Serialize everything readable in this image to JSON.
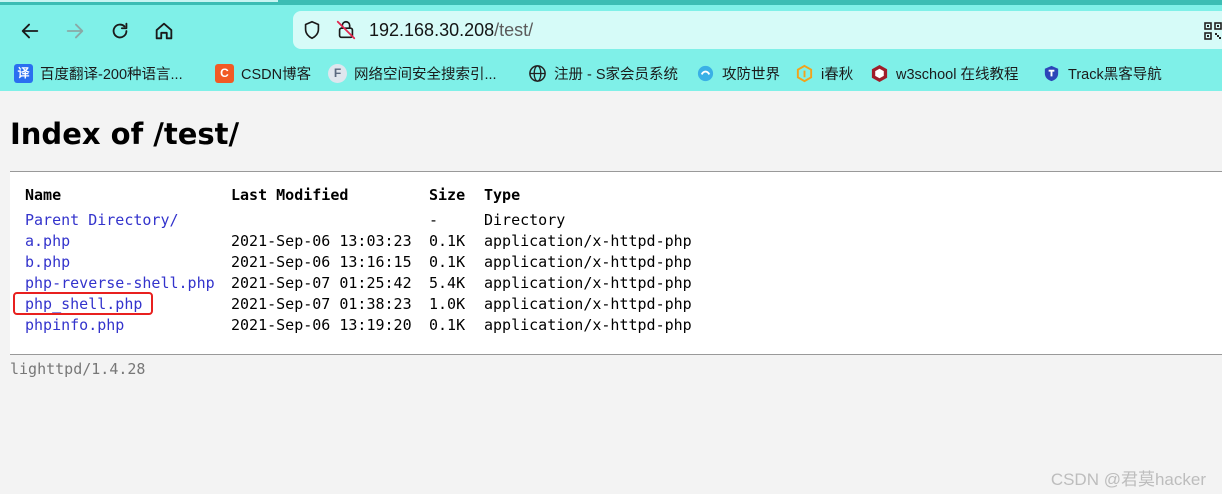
{
  "browser": {
    "url_host": "192.168.30.208",
    "url_path": "/test/",
    "bookmarks": [
      {
        "label": "百度翻译-200种语言...",
        "icon": "baidu-translate-icon",
        "icon_glyph": "译",
        "color": "#2a6ff0"
      },
      {
        "label": "CSDN博客",
        "icon": "csdn-icon",
        "icon_glyph": "C",
        "color": "#f15a24"
      },
      {
        "label": "网络空间安全搜索引...",
        "icon": "fofa-icon",
        "icon_glyph": "F",
        "color": "#7a8aa0"
      },
      {
        "label": "注册 - S家会员系统",
        "icon": "globe-icon",
        "icon_glyph": "",
        "color": "#222222"
      },
      {
        "label": "攻防世界",
        "icon": "adworld-icon",
        "icon_glyph": "",
        "color": "#3ab0e6"
      },
      {
        "label": "i春秋",
        "icon": "ichunqiu-icon",
        "icon_glyph": "",
        "color": "#f2a31b"
      },
      {
        "label": "w3school 在线教程",
        "icon": "w3school-icon",
        "icon_glyph": "",
        "color": "#a01e2a"
      },
      {
        "label": "Track黑客导航",
        "icon": "track-icon",
        "icon_glyph": "",
        "color": "#2c45b8"
      }
    ]
  },
  "page": {
    "title": "Index of /test/",
    "headers": {
      "name": "Name",
      "modified": "Last Modified",
      "size": "Size",
      "type": "Type"
    },
    "rows": [
      {
        "name": "Parent Directory/",
        "modified": "",
        "size": "-",
        "type": "Directory"
      },
      {
        "name": "a.php",
        "modified": "2021-Sep-06 13:03:23",
        "size": "0.1K",
        "type": "application/x-httpd-php"
      },
      {
        "name": "b.php",
        "modified": "2021-Sep-06 13:16:15",
        "size": "0.1K",
        "type": "application/x-httpd-php"
      },
      {
        "name": "php-reverse-shell.php",
        "modified": "2021-Sep-07 01:25:42",
        "size": "5.4K",
        "type": "application/x-httpd-php"
      },
      {
        "name": "php_shell.php",
        "modified": "2021-Sep-07 01:38:23",
        "size": "1.0K",
        "type": "application/x-httpd-php"
      },
      {
        "name": "phpinfo.php",
        "modified": "2021-Sep-06 13:19:20",
        "size": "0.1K",
        "type": "application/x-httpd-php"
      }
    ],
    "highlighted_row": "php_shell.php",
    "server_footer": "lighttpd/1.4.28"
  },
  "watermark": "CSDN @君莫hacker",
  "colors": {
    "chrome_bg": "#7ff0e8",
    "urlbar_bg": "#d6fbf8",
    "link": "#3333cc",
    "highlight": "#e8201f"
  }
}
